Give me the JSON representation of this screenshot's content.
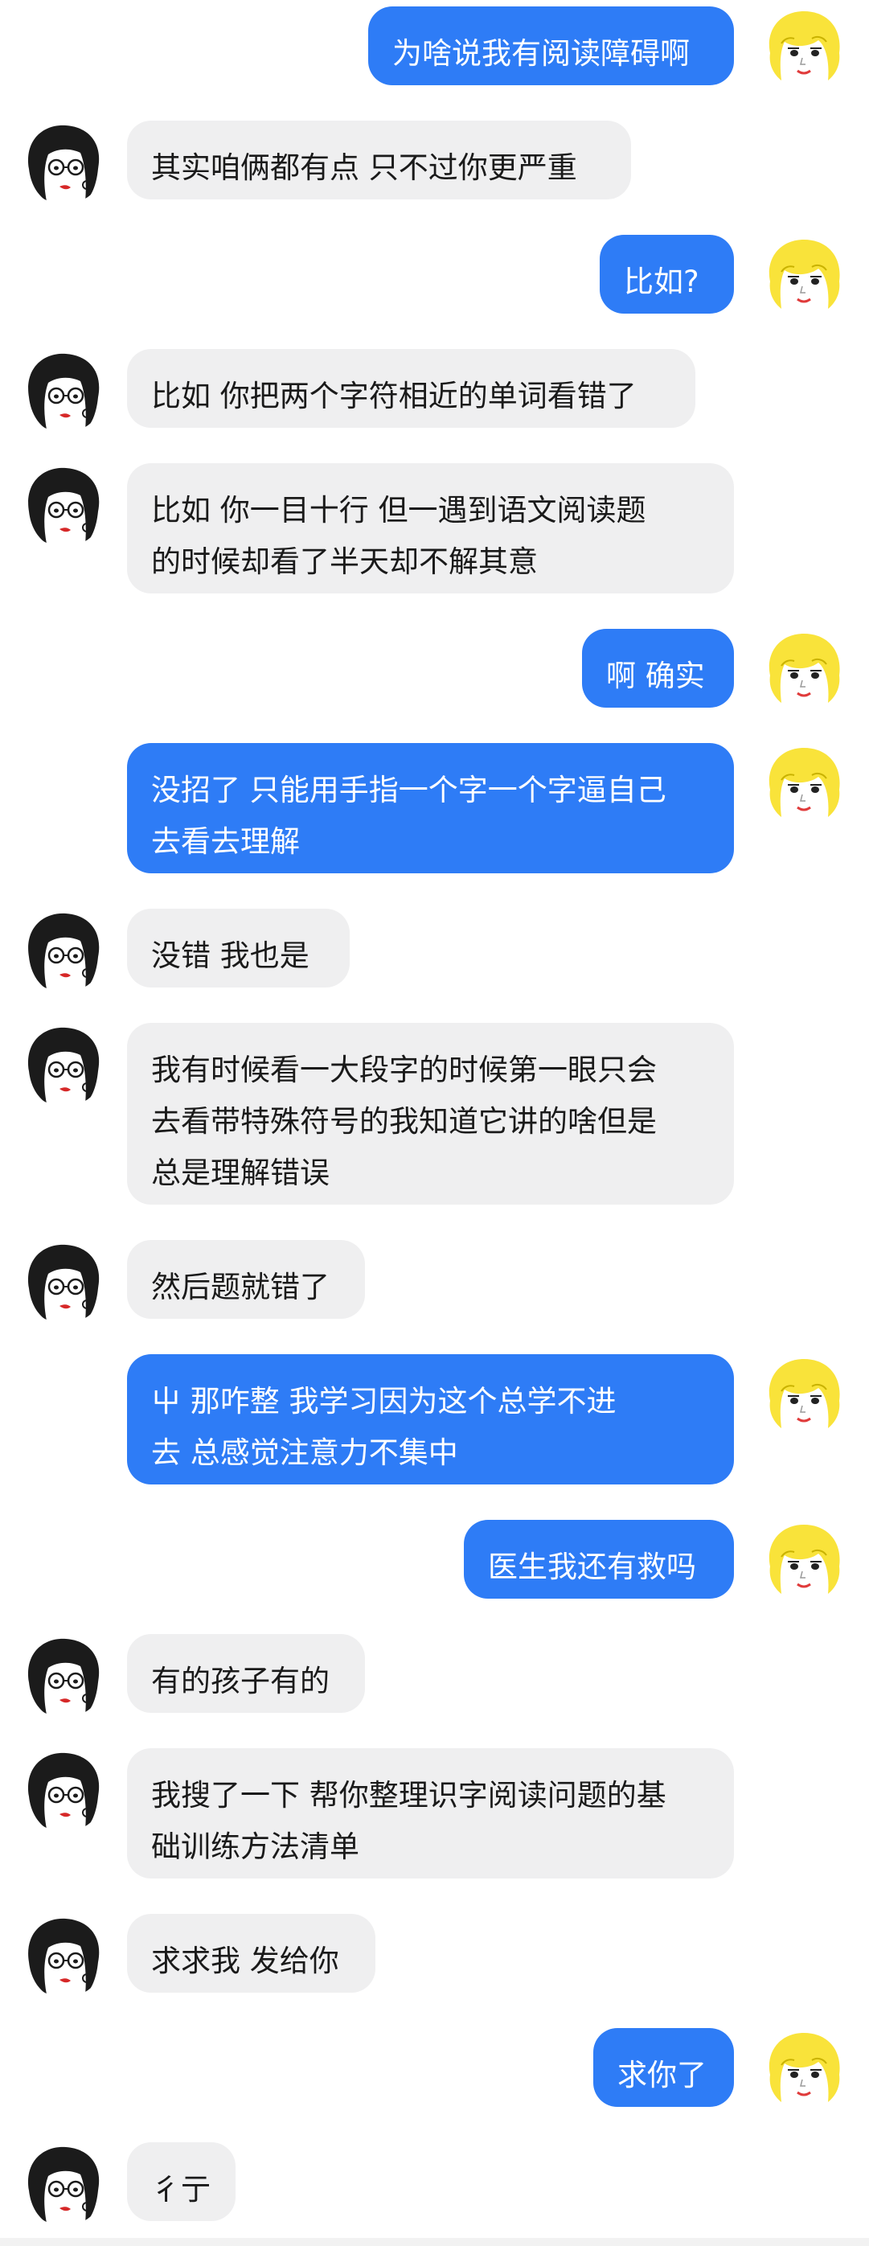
{
  "conversation": {
    "messages": [
      {
        "side": "right",
        "text": "为啥说我有阅读障碍啊"
      },
      {
        "side": "left",
        "text": "其实咱俩都有点 只不过你更严重"
      },
      {
        "side": "right",
        "text": "比如?"
      },
      {
        "side": "left",
        "text": "比如 你把两个字符相近的单词看错了"
      },
      {
        "side": "left",
        "text": "比如 你一目十行 但一遇到语文阅读题\n的时候却看了半天却不解其意"
      },
      {
        "side": "right",
        "text": "啊 确实"
      },
      {
        "side": "right",
        "text": "没招了 只能用手指一个字一个字逼自己\n去看去理解"
      },
      {
        "side": "left",
        "text": "没错 我也是"
      },
      {
        "side": "left",
        "text": "我有时候看一大段字的时候第一眼只会\n去看带特殊符号的我知道它讲的啥但是\n总是理解错误"
      },
      {
        "side": "left",
        "text": "然后题就错了"
      },
      {
        "side": "right",
        "text": "屮 那咋整 我学习因为这个总学不进\n去 总感觉注意力不集中"
      },
      {
        "side": "right",
        "text": "医生我还有救吗"
      },
      {
        "side": "left",
        "text": "有的孩子有的"
      },
      {
        "side": "left",
        "text": "我搜了一下 帮你整理识字阅读问题的基\n础训练方法清单"
      },
      {
        "side": "left",
        "text": "求求我 发给你"
      },
      {
        "side": "right",
        "text": "求你了"
      },
      {
        "side": "left",
        "text": "彳亍"
      }
    ]
  },
  "colors": {
    "self_bubble": "#2e7cf6",
    "other_bubble": "#efeff0"
  },
  "avatars": {
    "self": "blonde-girl-avatar-icon",
    "other": "dark-hair-girl-avatar-icon"
  }
}
